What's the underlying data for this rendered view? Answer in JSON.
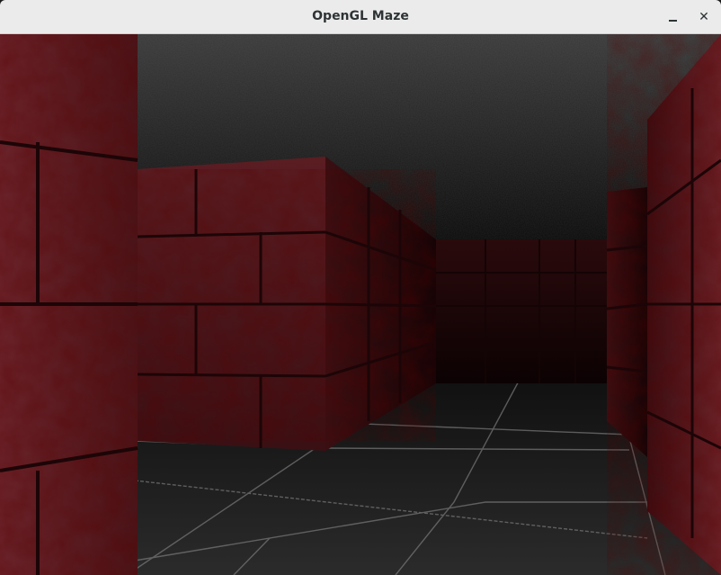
{
  "window": {
    "title": "OpenGL Maze",
    "minimize_symbol": "–",
    "close_symbol": "✕"
  },
  "scene": {
    "description_type": "3d-maze-first-person-view",
    "wall_color": "#5a1a1e",
    "wall_shadow_color": "#2a0b0d",
    "ceiling_color": "#1c1c1c",
    "floor_color": "#2a2a2a",
    "floor_grout_color": "#8a8a8a"
  }
}
